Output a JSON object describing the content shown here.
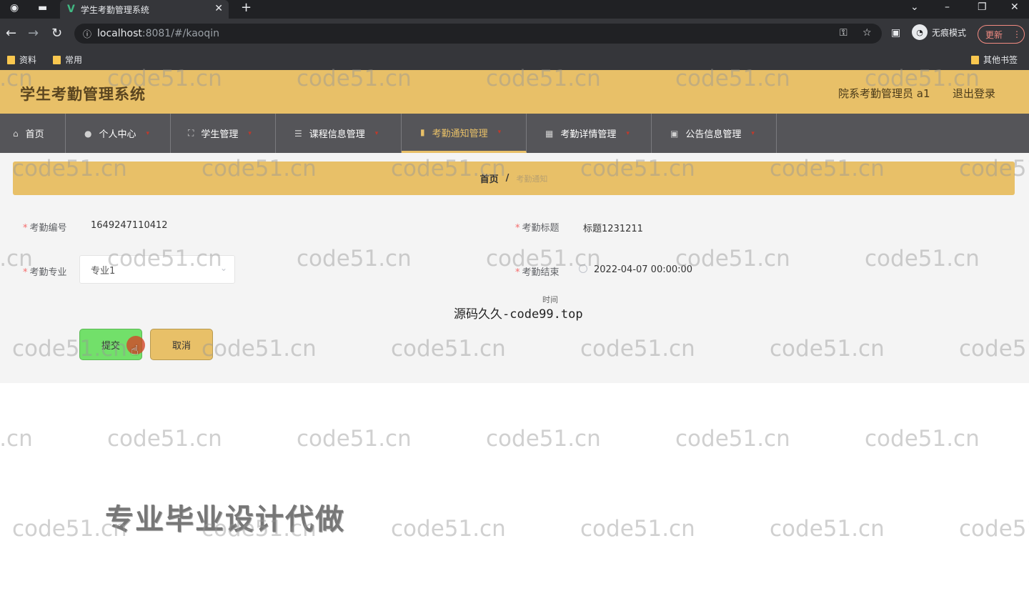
{
  "browser": {
    "tab_title": "学生考勤管理系统",
    "url_host": "localhost",
    "url_path": ":8081/#/kaoqin",
    "incognito_label": "无痕模式",
    "update_label": "更新",
    "bookmarks": [
      "资料",
      "常用"
    ],
    "other_bookmarks": "其他书签"
  },
  "header": {
    "app_title": "学生考勤管理系统",
    "user_role": "院系考勤管理员 a1",
    "logout_label": "退出登录"
  },
  "menu": [
    {
      "label": "首页",
      "icon": "home-icon",
      "caret": ""
    },
    {
      "label": "个人中心",
      "icon": "user-icon",
      "caret": "▾"
    },
    {
      "label": "学生管理",
      "icon": "expand-icon",
      "caret": "▾"
    },
    {
      "label": "课程信息管理",
      "icon": "list-icon",
      "caret": "▾"
    },
    {
      "label": "考勤通知管理",
      "icon": "bar-chart-icon",
      "caret": "▾"
    },
    {
      "label": "考勤详情管理",
      "icon": "grid-icon",
      "caret": "▾"
    },
    {
      "label": "公告信息管理",
      "icon": "picture-icon",
      "caret": "▾"
    }
  ],
  "breadcrumb": {
    "home": "首页",
    "separator": "/",
    "current": "考勤通知"
  },
  "form": {
    "kaoqin_no_label": "考勤编号",
    "kaoqin_no_value": "1649247110412",
    "title_label": "考勤标题",
    "title_value": "标题1231211",
    "major_label": "考勤专业",
    "major_value": "专业1",
    "end_time_label": "考勤结束",
    "end_time_label2": "时间",
    "end_time_value": "2022-04-07 00:00:00",
    "required_mark": "*",
    "submit_label": "提交",
    "cancel_label": "取消"
  },
  "overlays": {
    "middle_text": "源码久久-code99.top",
    "big_text": "专业毕业设计代做",
    "watermark": "code51.cn"
  },
  "colors": {
    "header_bg": "#e8c068",
    "menu_bg": "#555559",
    "submit_bg": "#72e06a",
    "cancel_bg": "#e8c068"
  }
}
